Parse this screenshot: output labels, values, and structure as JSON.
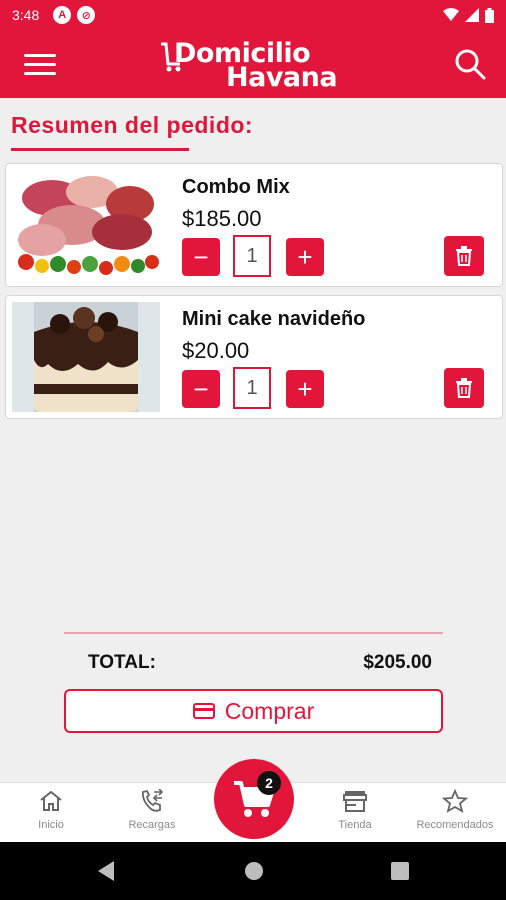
{
  "status": {
    "time": "3:48"
  },
  "app": {
    "logo_line1": "Domicilio",
    "logo_line2": "Havana"
  },
  "page": {
    "title": "Resumen del pedido:"
  },
  "items": [
    {
      "name": "Combo Mix",
      "price": "$185.00",
      "qty": "1"
    },
    {
      "name": "Mini cake navideño",
      "price": "$20.00",
      "qty": "1"
    }
  ],
  "controls": {
    "minus": "−",
    "plus": "+"
  },
  "summary": {
    "total_label": "TOTAL:",
    "total_value": "$205.00",
    "buy_label": "Comprar"
  },
  "nav": {
    "items": [
      {
        "label": "Inicio",
        "icon": "home-icon"
      },
      {
        "label": "Recargas",
        "icon": "phone-transfer-icon"
      },
      {
        "label": "Tienda",
        "icon": "store-icon"
      },
      {
        "label": "Recomendados",
        "icon": "star-icon"
      }
    ],
    "cart_count": "2"
  },
  "colors": {
    "primary": "#e2163a",
    "background": "#efefef"
  }
}
